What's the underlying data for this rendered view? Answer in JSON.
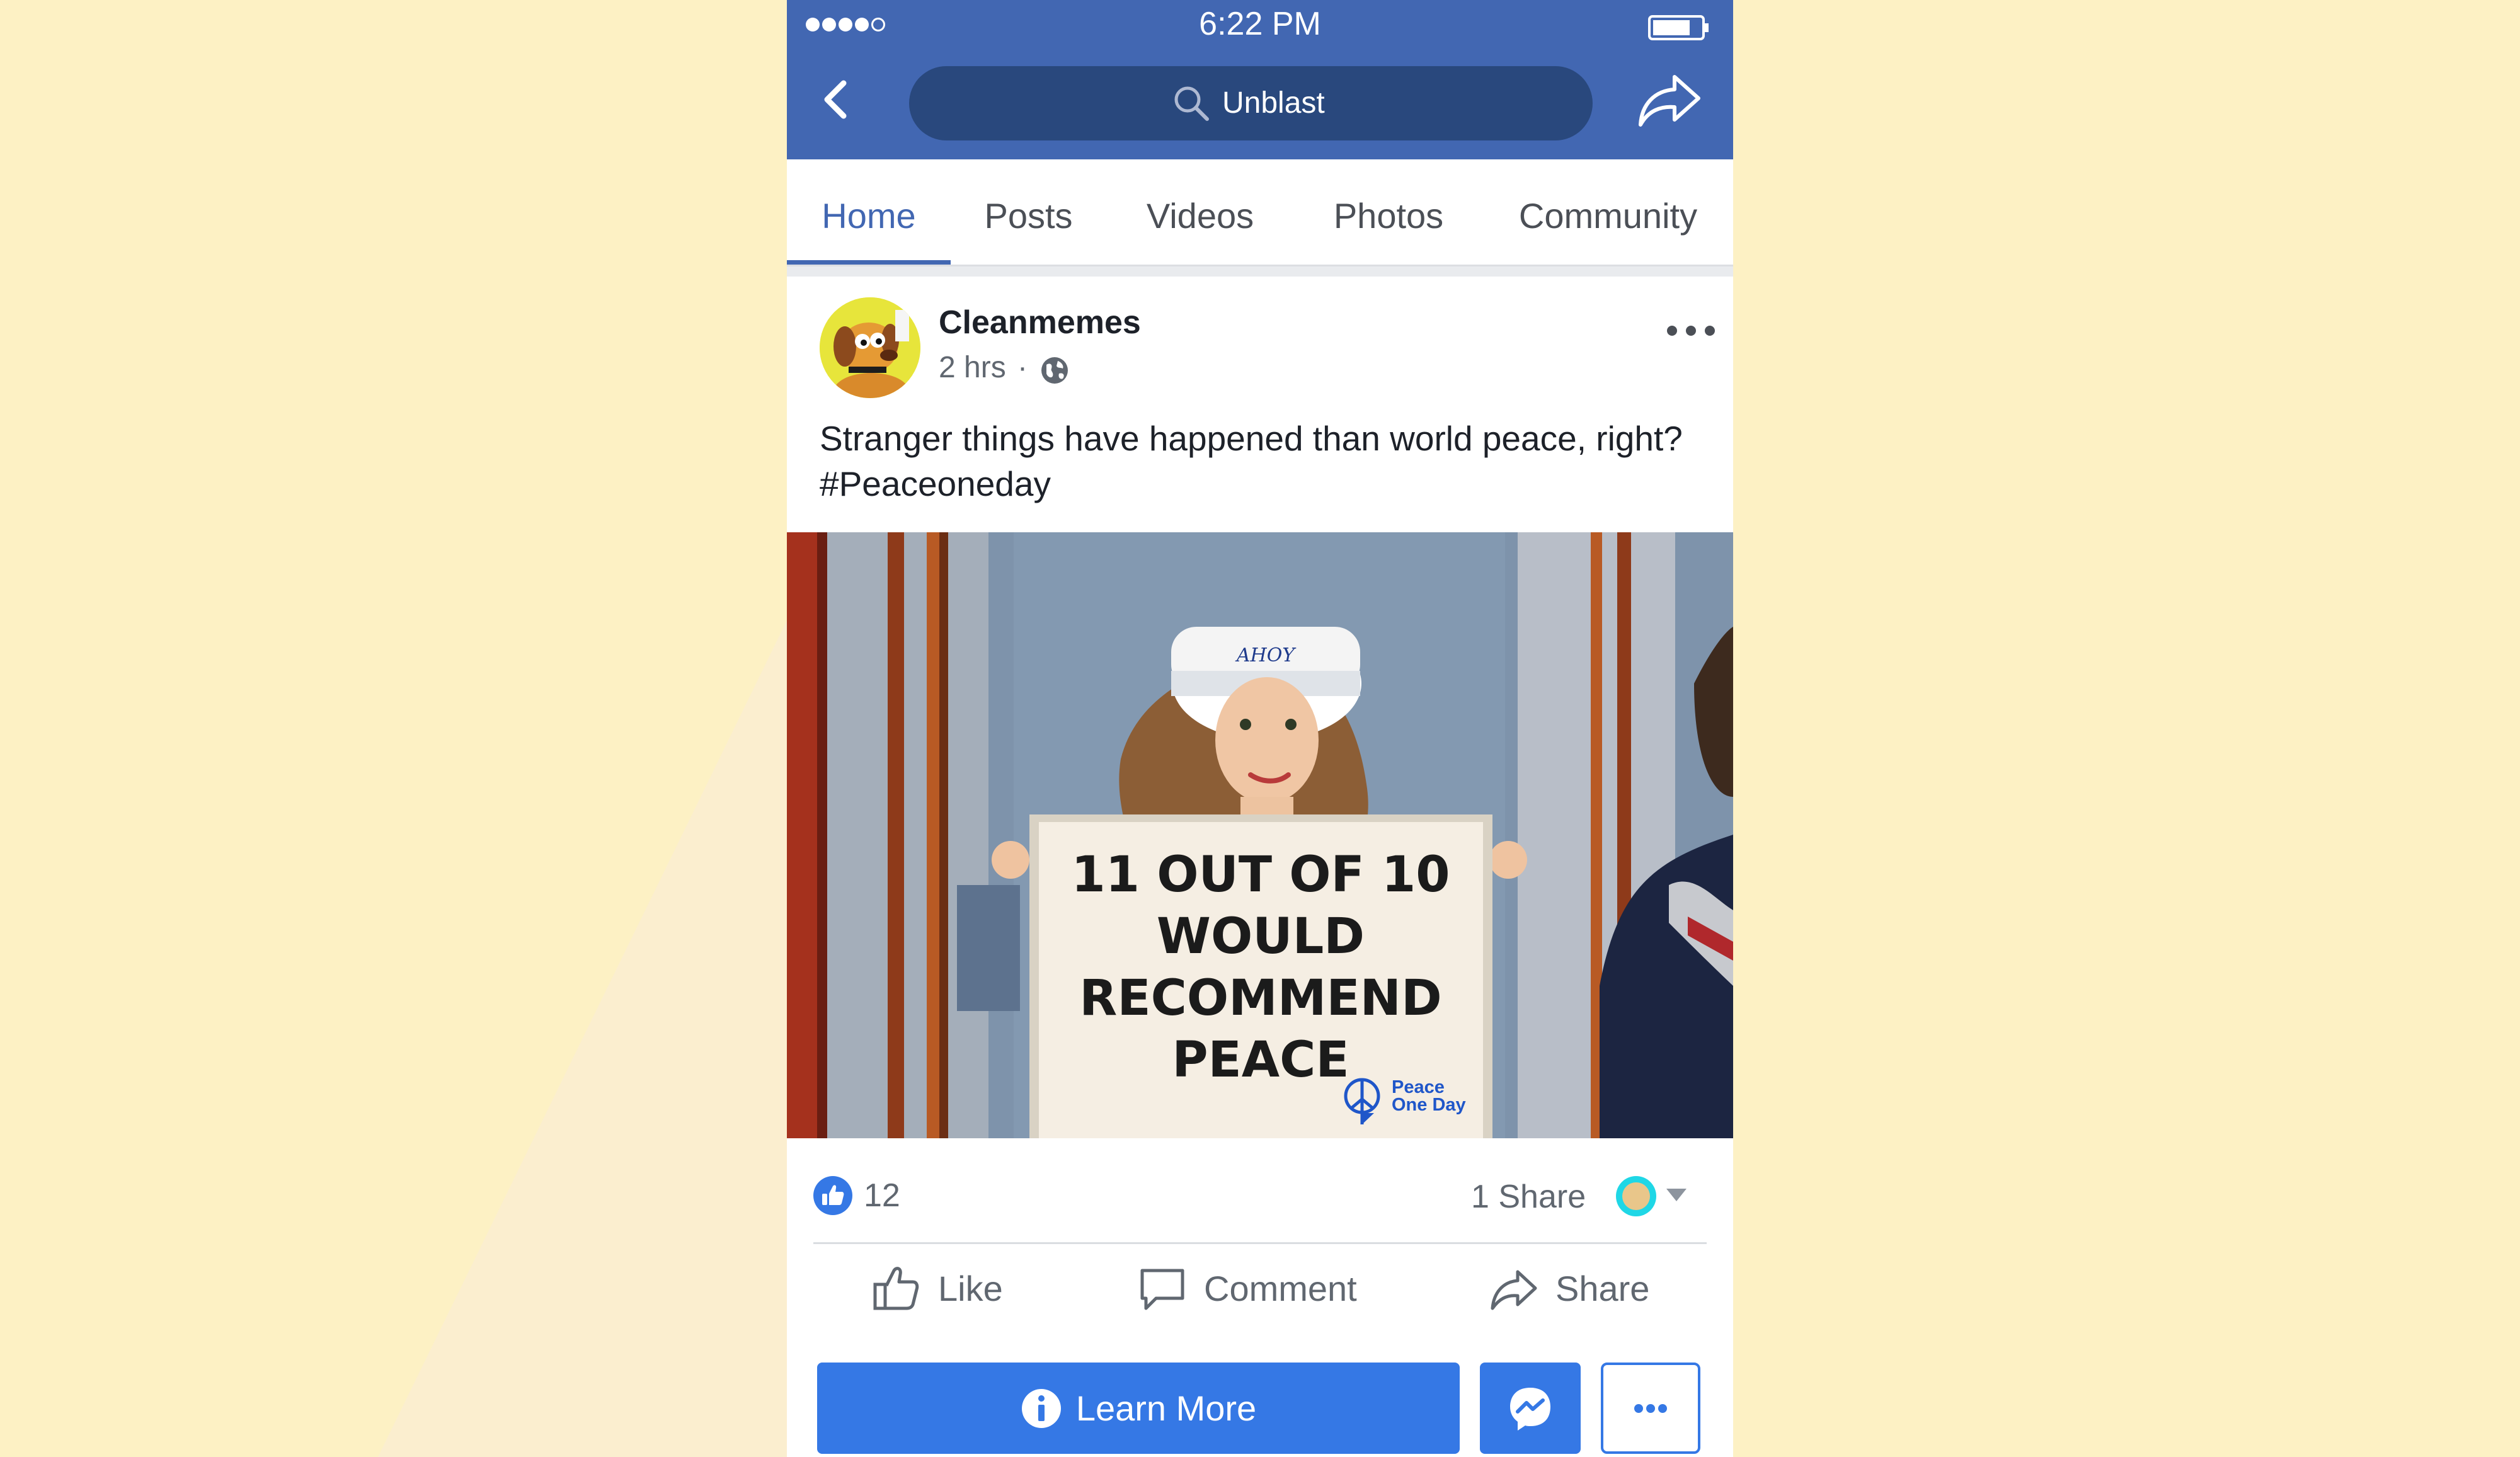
{
  "status_bar": {
    "time": "6:22 PM"
  },
  "header": {
    "search_text": "Unblast"
  },
  "tabs": [
    {
      "label": "Home",
      "active": true
    },
    {
      "label": "Posts"
    },
    {
      "label": "Videos"
    },
    {
      "label": "Photos"
    },
    {
      "label": "Community"
    }
  ],
  "post": {
    "page_name": "Cleanmemes",
    "time": "2 hrs",
    "separator": "·",
    "text": "Stranger things have happened than world peace, right? #Peaceoneday",
    "image": {
      "hat_text": "AHOY",
      "sign_lines": [
        "11 OUT OF 10",
        "WOULD",
        "RECOMMEND",
        "PEACE"
      ],
      "logo_line1": "Peace",
      "logo_line2": "One Day"
    }
  },
  "stats": {
    "likes": "12",
    "shares": "1 Share"
  },
  "actions": {
    "like": "Like",
    "comment": "Comment",
    "share": "Share"
  },
  "cta": {
    "learn_more": "Learn More"
  },
  "colors": {
    "facebook_blue": "#4267b2",
    "search_pill": "#29487d",
    "cta_blue": "#3578e5",
    "page_background": "#fdf1c4"
  },
  "icons": {
    "back": "chevron-left-icon",
    "search": "search-icon",
    "share_header": "share-arrow-icon",
    "globe": "globe-icon",
    "more": "more-dots-icon",
    "like_reaction": "thumbs-up-icon",
    "comment": "comment-bubble-icon",
    "info": "info-icon",
    "messenger": "messenger-icon"
  }
}
